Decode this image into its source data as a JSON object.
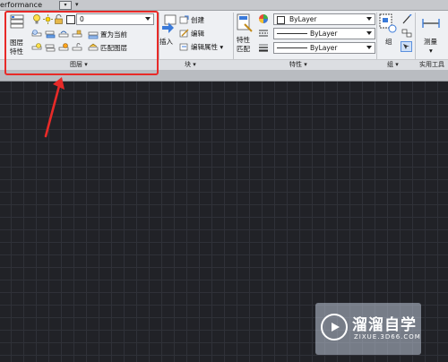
{
  "titlebar": {
    "workspace_text": "erformance",
    "workspace_dd": "▾",
    "overflow_arrow": "▾"
  },
  "ribbon": {
    "layers": {
      "layer_properties_label_line1": "图层",
      "layer_properties_label_line2": "特性",
      "current_layer_value": "0",
      "set_current_label": "置为当前",
      "match_layer_label": "匹配图层",
      "footer_label": "图层 ▾"
    },
    "block": {
      "insert_label": "插入",
      "create_label": "创建",
      "edit_label": "编辑",
      "edit_attributes_label": "编辑属性 ▾",
      "footer_label": "块 ▾"
    },
    "properties": {
      "match_label_line1": "特性",
      "match_label_line2": "匹配",
      "color_value": "ByLayer",
      "linetype_value": "ByLayer",
      "lineweight_value": "ByLayer",
      "footer_label": "特性 ▾"
    },
    "groups": {
      "group_label": "组",
      "footer_label": "组 ▾"
    },
    "utilities": {
      "measure_label": "测量",
      "footer_label": "实用工具"
    }
  },
  "watermark": {
    "title": "溜溜自学",
    "subtitle": "ZIXUE.3D66.COM"
  },
  "colors": {
    "highlight": "#e82a28",
    "canvas": "#212227",
    "ribbon": "#eef0f3"
  }
}
